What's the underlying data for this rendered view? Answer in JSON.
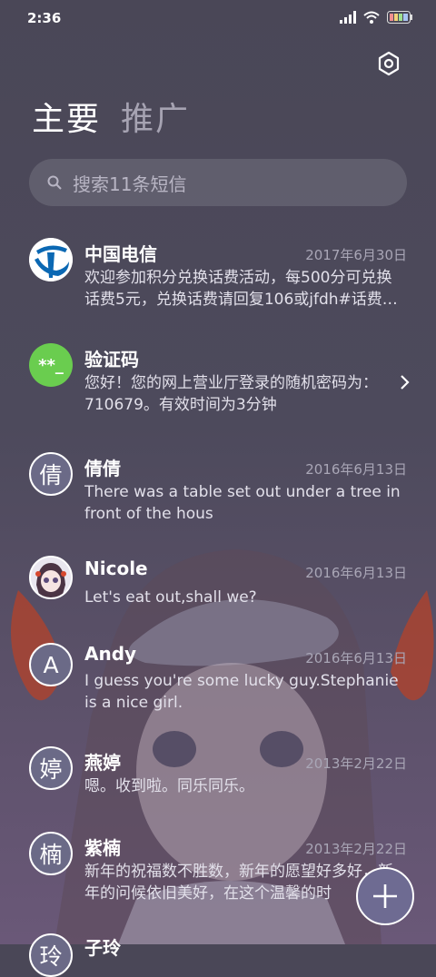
{
  "status": {
    "time": "2:36"
  },
  "tabs": [
    {
      "label": "主要"
    },
    {
      "label": "推广"
    }
  ],
  "search": {
    "placeholder": "搜索11条短信"
  },
  "conversations": [
    {
      "name": "中国电信",
      "date": "2017年6月30日",
      "preview": "欢迎参加积分兑换话费活动，每500分可兑换话费5元，兑换话费请回复106或jfdh#话费…",
      "avatar_type": "telecom-logo"
    },
    {
      "name": "验证码",
      "date": "",
      "preview": "您好！您的网上营业厅登录的随机密码为：710679。有效时间为3分钟",
      "avatar_text": "**_"
    },
    {
      "name": "倩倩",
      "date": "2016年6月13日",
      "preview": "There was a table set out under a tree in front of the hous",
      "avatar_letter": "倩"
    },
    {
      "name": "Nicole",
      "date": "2016年6月13日",
      "preview": "Let's eat out,shall we?",
      "avatar_type": "anime-photo"
    },
    {
      "name": "Andy",
      "date": "2016年6月13日",
      "preview": "I guess you're some lucky guy.Stephanie is a nice girl.",
      "avatar_letter": "A"
    },
    {
      "name": "燕婷",
      "date": "2013年2月22日",
      "preview": "嗯。收到啦。同乐同乐。",
      "avatar_letter": "婷"
    },
    {
      "name": "紫楠",
      "date": "2013年2月22日",
      "preview": "新年的祝福数不胜数，新年的愿望好多好，新年的问候依旧美好，在这个温馨的时",
      "avatar_letter": "楠"
    },
    {
      "name": "子玲",
      "date": "",
      "preview": "",
      "avatar_letter": "玲"
    }
  ],
  "colors": {
    "background": "#4a4757",
    "accent_green": "#6acd4f",
    "telecom_blue": "#0b68b3",
    "fab": "#6e6b92"
  },
  "icons": [
    "settings-icon",
    "search-icon",
    "chevron-right-icon",
    "plus-icon",
    "signal-icon",
    "wifi-icon",
    "battery-icon"
  ]
}
